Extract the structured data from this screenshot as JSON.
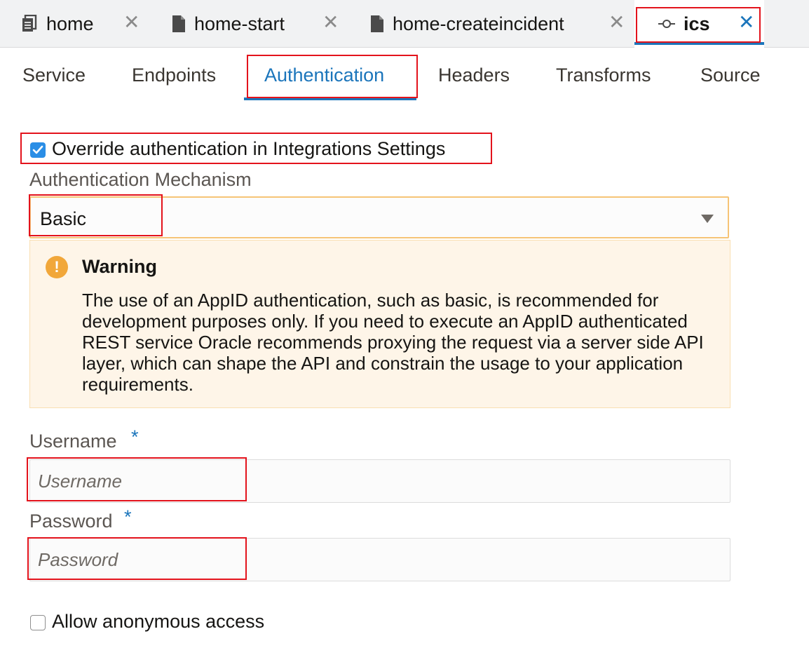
{
  "doc_tabs": [
    {
      "label": "home",
      "icon": "pages-icon",
      "close": "✕",
      "active": false
    },
    {
      "label": "home-start",
      "icon": "file-icon",
      "close": "✕",
      "active": false
    },
    {
      "label": "home-createincident",
      "icon": "file-icon",
      "close": "✕",
      "active": false
    },
    {
      "label": "ics",
      "icon": "service-connection-icon",
      "close": "✕",
      "active": true
    }
  ],
  "sub_tabs": [
    "Service",
    "Endpoints",
    "Authentication",
    "Headers",
    "Transforms",
    "Source"
  ],
  "active_sub_tab": "Authentication",
  "override": {
    "label": "Override authentication in Integrations Settings",
    "checked": true
  },
  "mechanism": {
    "label": "Authentication Mechanism",
    "value": "Basic"
  },
  "warning": {
    "title": "Warning",
    "body": "The use of an AppID authentication, such as basic, is recommended for development purposes only. If you need to execute an AppID authenticated REST service Oracle recommends proxying the request via a server side API layer, which can shape the API and constrain the usage to your application requirements."
  },
  "username": {
    "label": "Username",
    "required_mark": "*",
    "placeholder": "Username",
    "value": ""
  },
  "password": {
    "label": "Password",
    "required_mark": "*",
    "placeholder": "Password",
    "value": ""
  },
  "anonymous": {
    "label": "Allow anonymous access",
    "checked": false
  },
  "colors": {
    "accent": "#1b75bb",
    "highlight": "#e3131c",
    "warning_bg": "#fef5e8",
    "warning_icon": "#f1a73a",
    "select_border": "#f6c476"
  }
}
